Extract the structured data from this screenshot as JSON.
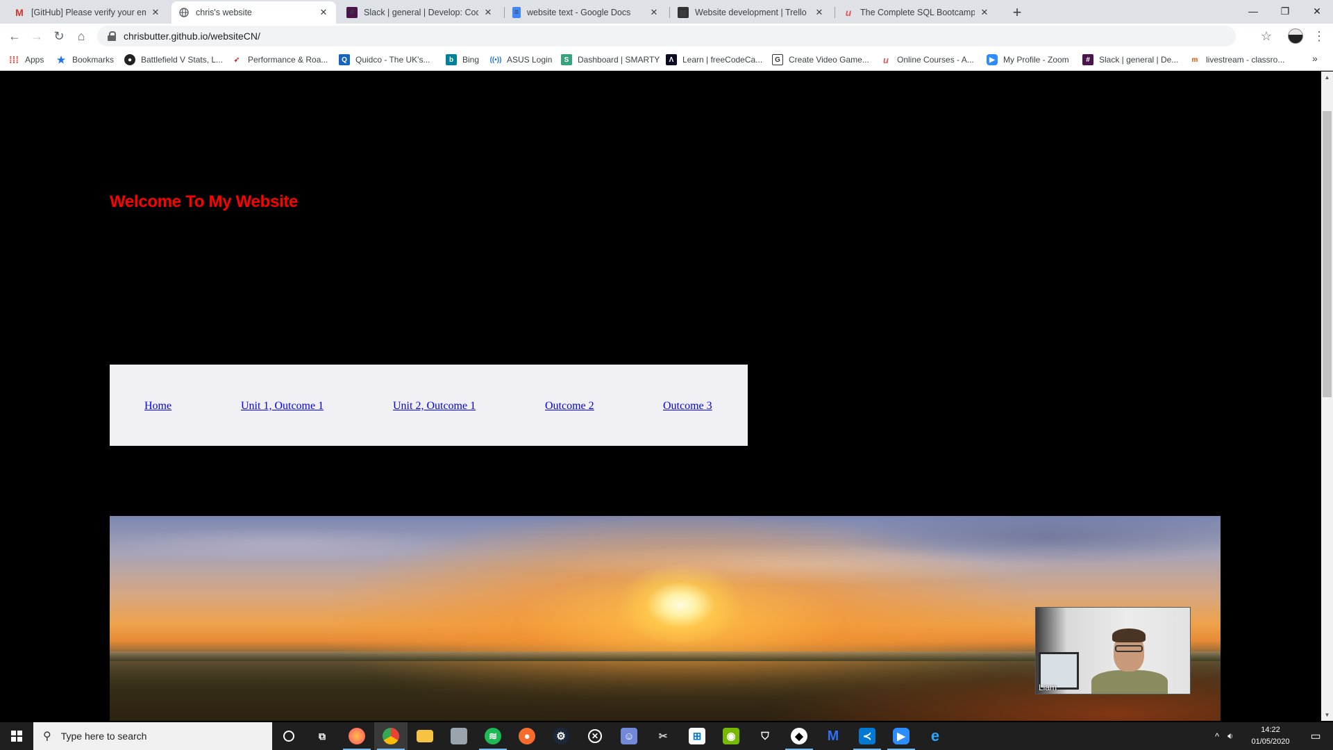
{
  "browser": {
    "tabs": [
      {
        "title": "[GitHub] Please verify your email",
        "icon": "gmail-icon",
        "active": false
      },
      {
        "title": "chris's website",
        "icon": "globe-icon",
        "active": true
      },
      {
        "title": "Slack | general | Develop: Coding",
        "icon": "slack-icon",
        "active": false
      },
      {
        "title": "website text - Google Docs",
        "icon": "google-docs-icon",
        "active": false
      },
      {
        "title": "Website development | Trello",
        "icon": "trello-icon",
        "active": false
      },
      {
        "title": "The Complete SQL Bootcamp for",
        "icon": "udemy-icon",
        "active": false
      }
    ],
    "url": "chrisbutter.github.io/websiteCN/",
    "bookmarks": [
      {
        "label": "Apps",
        "icon": "apps-grid-icon"
      },
      {
        "label": "Bookmarks",
        "icon": "star-icon"
      },
      {
        "label": "Battlefield V Stats, L...",
        "icon": "battlefield-icon"
      },
      {
        "label": "Performance & Roa...",
        "icon": "performance-icon"
      },
      {
        "label": "Quidco - The UK's...",
        "icon": "quidco-icon"
      },
      {
        "label": "Bing",
        "icon": "bing-icon"
      },
      {
        "label": "ASUS Login",
        "icon": "asus-icon"
      },
      {
        "label": "Dashboard | SMARTY",
        "icon": "smarty-icon"
      },
      {
        "label": "Learn | freeCodeCa...",
        "icon": "freecodecamp-icon"
      },
      {
        "label": "Create Video Game...",
        "icon": "document-icon"
      },
      {
        "label": "Online Courses - A...",
        "icon": "udemy-icon"
      },
      {
        "label": "My Profile - Zoom",
        "icon": "zoom-icon"
      },
      {
        "label": "Slack | general | De...",
        "icon": "slack-icon"
      },
      {
        "label": "livestream - classro...",
        "icon": "classroom-icon"
      }
    ]
  },
  "page": {
    "heading": "Welcome To My Website",
    "nav": [
      "Home",
      "Unit 1, Outcome 1",
      "Unit 2, Outcome 1",
      "Outcome 2",
      "Outcome 3"
    ],
    "hero_image": "sunset-landscape"
  },
  "video_overlay": {
    "name": "Liam"
  },
  "taskbar": {
    "search_placeholder": "Type here to search",
    "time": "14:22",
    "date": "01/05/2020"
  },
  "colors": {
    "heading": "#ff0000",
    "link": "#0000ee",
    "nav_bg": "#f1f0f5",
    "page_bg": "#000000"
  }
}
